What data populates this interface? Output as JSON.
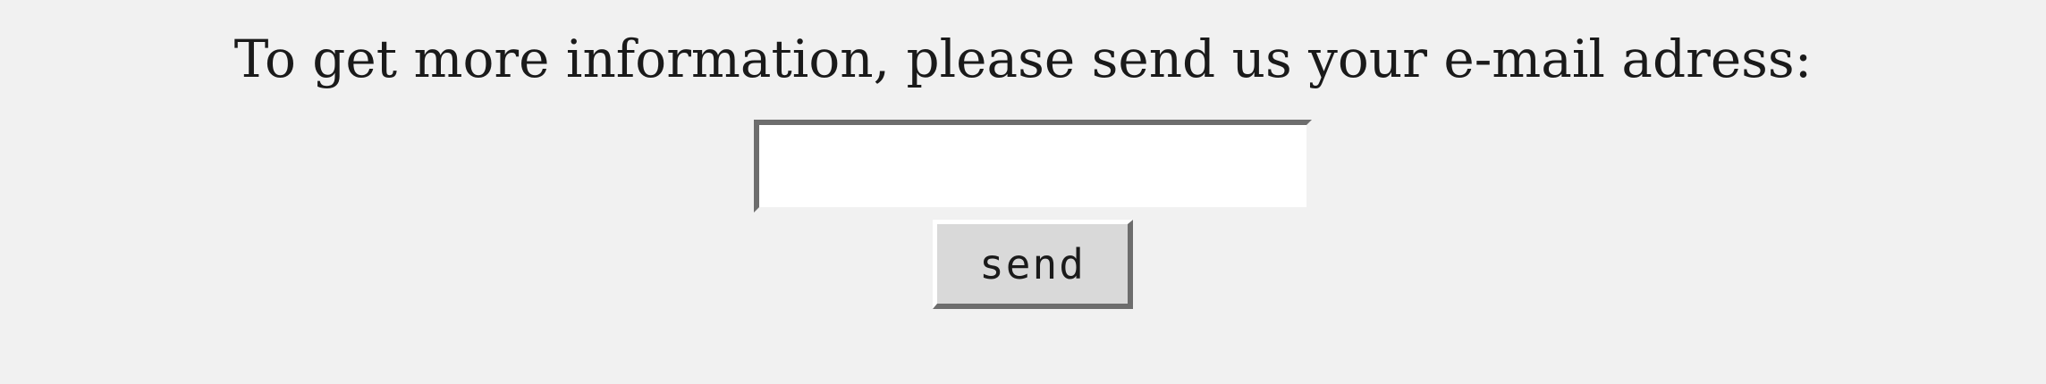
{
  "form": {
    "prompt": "To get more information, please send us your e-mail adress:",
    "email_value": "",
    "send_label": "send"
  }
}
